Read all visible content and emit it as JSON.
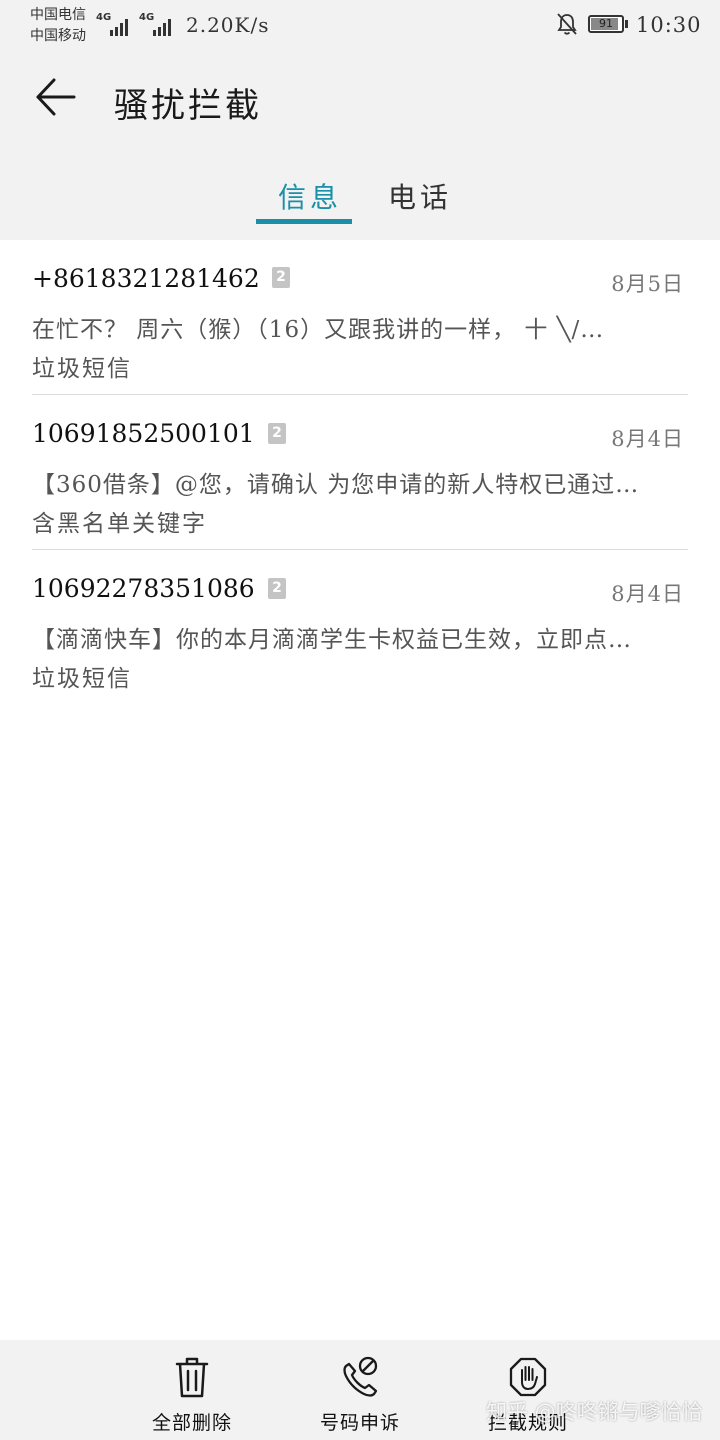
{
  "status_bar": {
    "carrier1": "中国电信",
    "carrier2": "中国移动",
    "sim1_network": "4G",
    "sim2_network": "4G",
    "net_speed": "2.20K/s",
    "battery": "91",
    "battery_level": 0.91,
    "time": "10:30"
  },
  "header": {
    "title": "骚扰拦截",
    "back_icon": "arrow-left-icon"
  },
  "tabs": [
    {
      "label": "信息",
      "active": true
    },
    {
      "label": "电话",
      "active": false
    }
  ],
  "colors": {
    "accent": "#1a8fa8",
    "background": "#f2f2f2"
  },
  "messages": [
    {
      "sender": "+8618321281462",
      "sim": "2",
      "date": "8月5日",
      "preview": "在忙不？ 周六（猴）（16）又跟我讲的一样， 十 ╲/…",
      "category": "垃圾短信"
    },
    {
      "sender": "10691852500101",
      "sim": "2",
      "date": "8月4日",
      "preview": "【360借条】@您，请确认 为您申请的新人特权已通过…",
      "category": "含黑名单关键字"
    },
    {
      "sender": "10692278351086",
      "sim": "2",
      "date": "8月4日",
      "preview": "【滴滴快车】你的本月滴滴学生卡权益已生效，立即点…",
      "category": "垃圾短信"
    }
  ],
  "bottom_bar": {
    "delete_all": {
      "label": "全部删除",
      "icon": "trash-icon"
    },
    "appeal": {
      "label": "号码申诉",
      "icon": "phone-blocked-icon"
    },
    "rules": {
      "label": "拦截规则",
      "icon": "stop-hand-icon"
    }
  },
  "watermark": "知乎 @咚咚锵与嗲恰恰"
}
